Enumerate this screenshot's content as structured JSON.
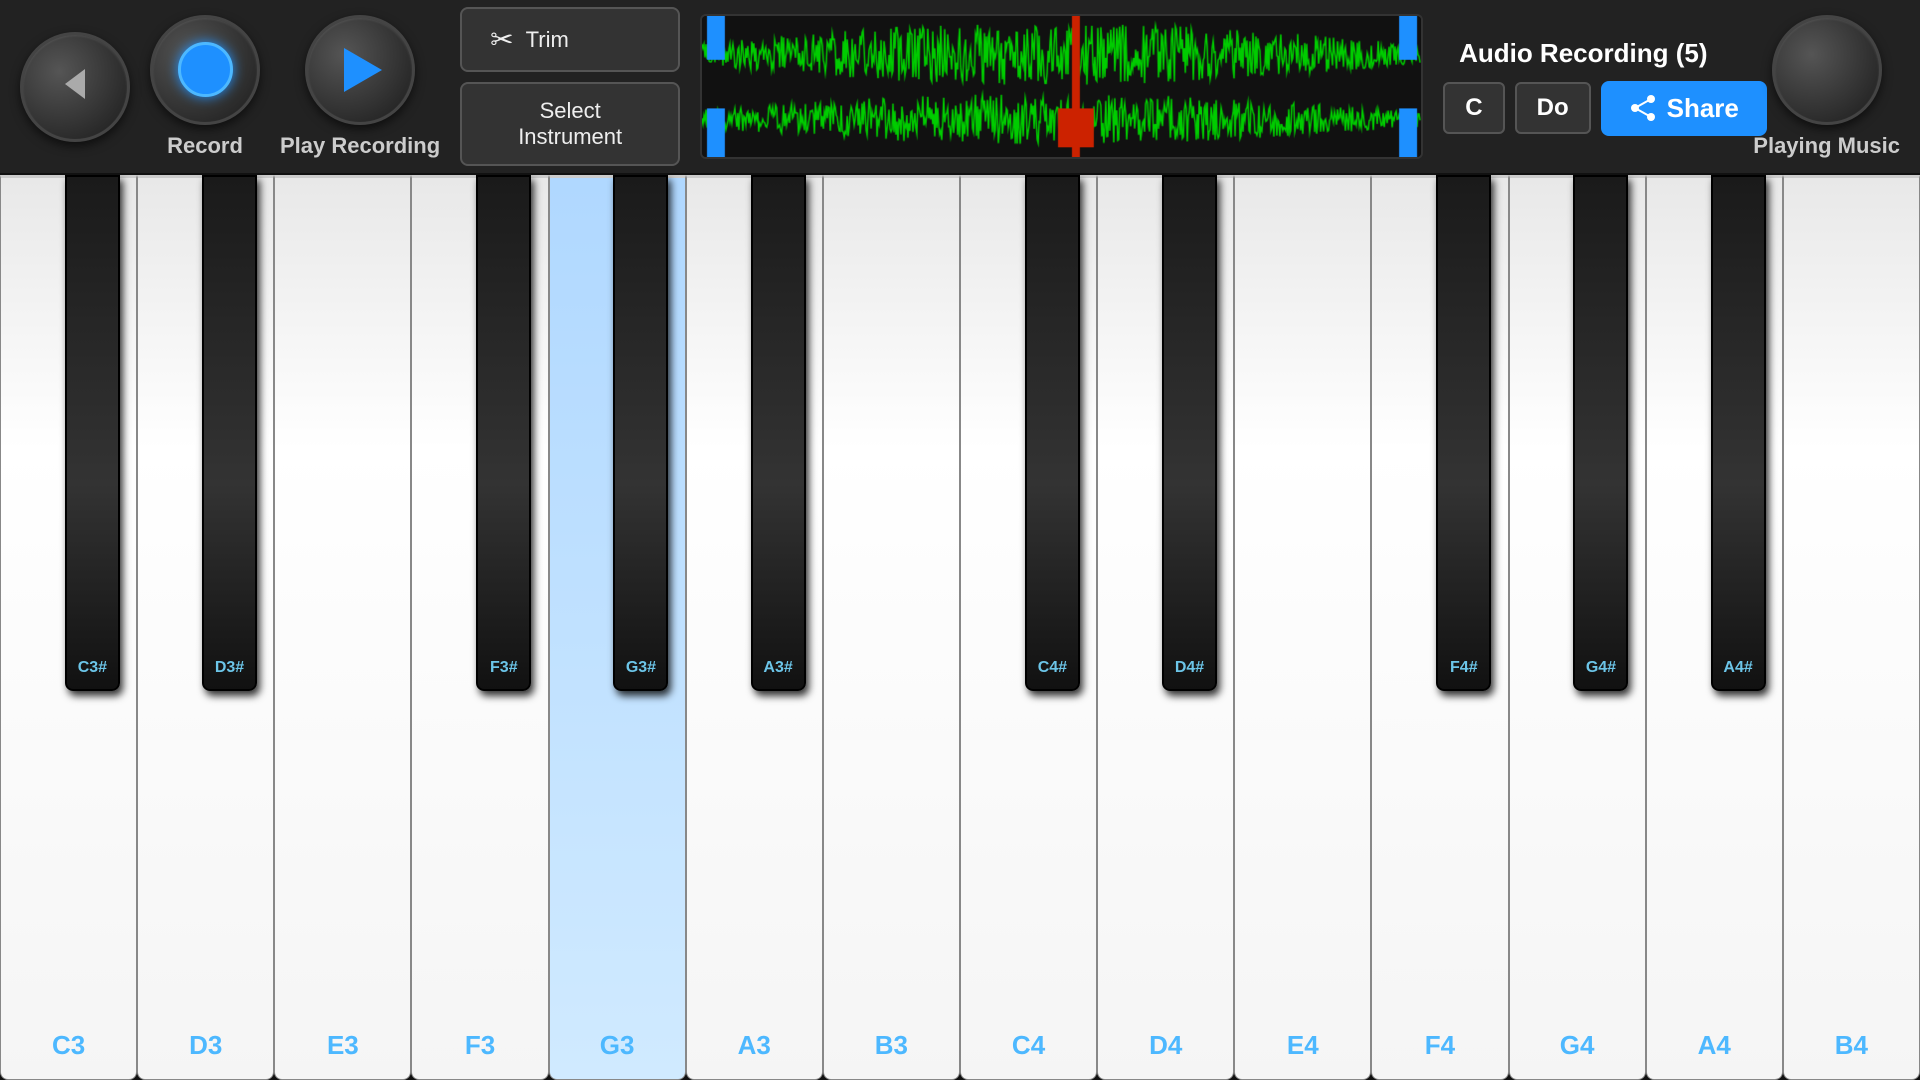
{
  "header": {
    "back_label": "",
    "record_label": "Record",
    "play_recording_label": "Play Recording",
    "trim_label": "Trim",
    "select_instrument_label": "Select Instrument",
    "audio_recording_title": "Audio Recording (5)",
    "note_c": "C",
    "note_do": "Do",
    "share_label": "Share",
    "playing_music_label": "Playing Music"
  },
  "piano": {
    "white_keys": [
      {
        "note": "C3",
        "pressed": false
      },
      {
        "note": "D3",
        "pressed": false
      },
      {
        "note": "E3",
        "pressed": false
      },
      {
        "note": "F3",
        "pressed": false
      },
      {
        "note": "G3",
        "pressed": true
      },
      {
        "note": "A3",
        "pressed": false
      },
      {
        "note": "B3",
        "pressed": false
      },
      {
        "note": "C4",
        "pressed": false
      },
      {
        "note": "D4",
        "pressed": false
      },
      {
        "note": "E4",
        "pressed": false
      },
      {
        "note": "F4",
        "pressed": false
      },
      {
        "note": "G4",
        "pressed": false
      },
      {
        "note": "A4",
        "pressed": false
      },
      {
        "note": "B4",
        "pressed": false
      }
    ],
    "black_keys": [
      {
        "note": "C3#",
        "offset_index": 0
      },
      {
        "note": "D3#",
        "offset_index": 1
      },
      {
        "note": "F3#",
        "offset_index": 3
      },
      {
        "note": "G3#",
        "offset_index": 4
      },
      {
        "note": "A3#",
        "offset_index": 5
      },
      {
        "note": "C4#",
        "offset_index": 7
      },
      {
        "note": "D4#",
        "offset_index": 8
      },
      {
        "note": "F4#",
        "offset_index": 10
      },
      {
        "note": "G4#",
        "offset_index": 11
      },
      {
        "note": "A4#",
        "offset_index": 12
      }
    ]
  },
  "colors": {
    "accent_blue": "#1e90ff",
    "key_label": "#4db8ff",
    "black_key_label": "#6cc5e8"
  }
}
